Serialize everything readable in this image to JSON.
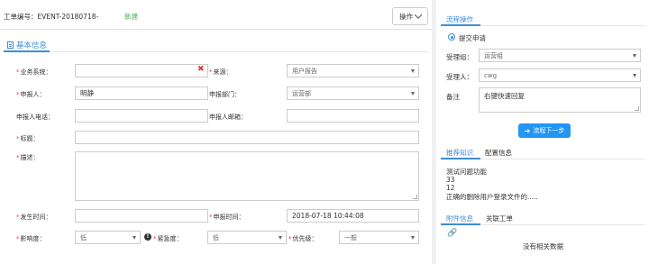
{
  "ticket": {
    "id_label": "工单编号：",
    "id_value": "EVENT-20180718-",
    "status": "新建",
    "op_button": "操作"
  },
  "section": {
    "title": "基本信息"
  },
  "form": {
    "business_system": {
      "label": "业务系统：",
      "value": ""
    },
    "source": {
      "label": "来源：",
      "value": "用户报告"
    },
    "reporter": {
      "label": "申报人：",
      "value": "明静"
    },
    "report_dept": {
      "label": "申报部门：",
      "value": "运营部"
    },
    "reporter_phone": {
      "label": "申报人电话：",
      "value": ""
    },
    "reporter_email": {
      "label": "申报人邮箱：",
      "value": ""
    },
    "title": {
      "label": "标题：",
      "value": ""
    },
    "description": {
      "label": "描述：",
      "value": ""
    },
    "occur_time": {
      "label": "发生时间：",
      "value": ""
    },
    "report_time": {
      "label": "申报时间：",
      "value": "2018-07-18 10:44:08"
    },
    "impact": {
      "label": "影响度：",
      "value": "低"
    },
    "urgency": {
      "label": "紧急度：",
      "value": "低"
    },
    "priority": {
      "label": "优先级：",
      "value": "一般"
    }
  },
  "flow": {
    "tab_label": "流程操作",
    "radio_label": "提交申请",
    "group_label": "受理组：",
    "group_value": "运营组",
    "handler_label": "受理人：",
    "handler_value": "cwg",
    "remark_label": "备注",
    "remark_value": "右键快速回复",
    "next_button": "流程下一步"
  },
  "kb": {
    "tab_active": "推荐知识",
    "tab_inactive": "配置信息",
    "lines": [
      "测试问题功能",
      "33",
      "12",
      "正确的删除用户登录文件的....."
    ]
  },
  "attach": {
    "tab_active": "附件信息",
    "tab_inactive": "关联工单",
    "empty_text": "没有相关数据"
  },
  "colors": {
    "accent": "#3f8cd8",
    "required": "#e53935",
    "status_new": "#4caf50",
    "button": "#2196f3"
  }
}
